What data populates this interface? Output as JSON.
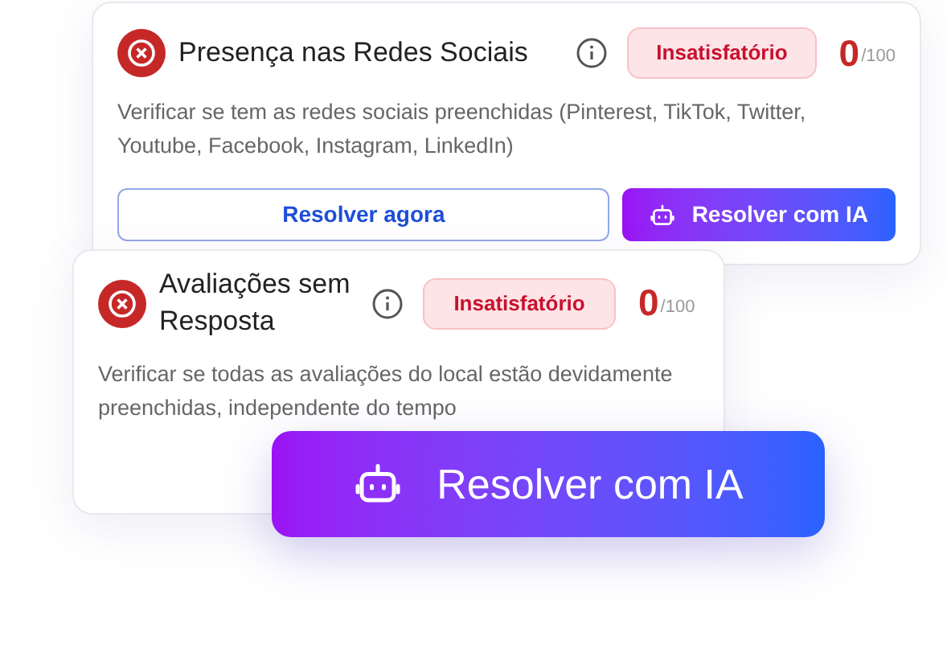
{
  "cards": [
    {
      "passed": false,
      "title": "Presença nas Redes Sociais",
      "status": "Insatisfatório",
      "score": "0",
      "max": "/100",
      "description": "Verificar se tem as redes sociais preenchidas (Pinterest, TikTok, Twitter, Youtube, Facebook, Instagram, LinkedIn)",
      "buttons": [
        {
          "kind": "outline",
          "label": "Resolver agora"
        },
        {
          "kind": "ai",
          "label": "Resolver com IA"
        }
      ]
    },
    {
      "passed": false,
      "title": "Avaliações sem Resposta",
      "status": "Insatisfatório",
      "score": "0",
      "max": "/100",
      "description": "Verificar se todas as avaliações do local estão devidamente preenchidas, independente do tempo"
    }
  ],
  "floating_button": {
    "label": "Resolver com IA"
  }
}
